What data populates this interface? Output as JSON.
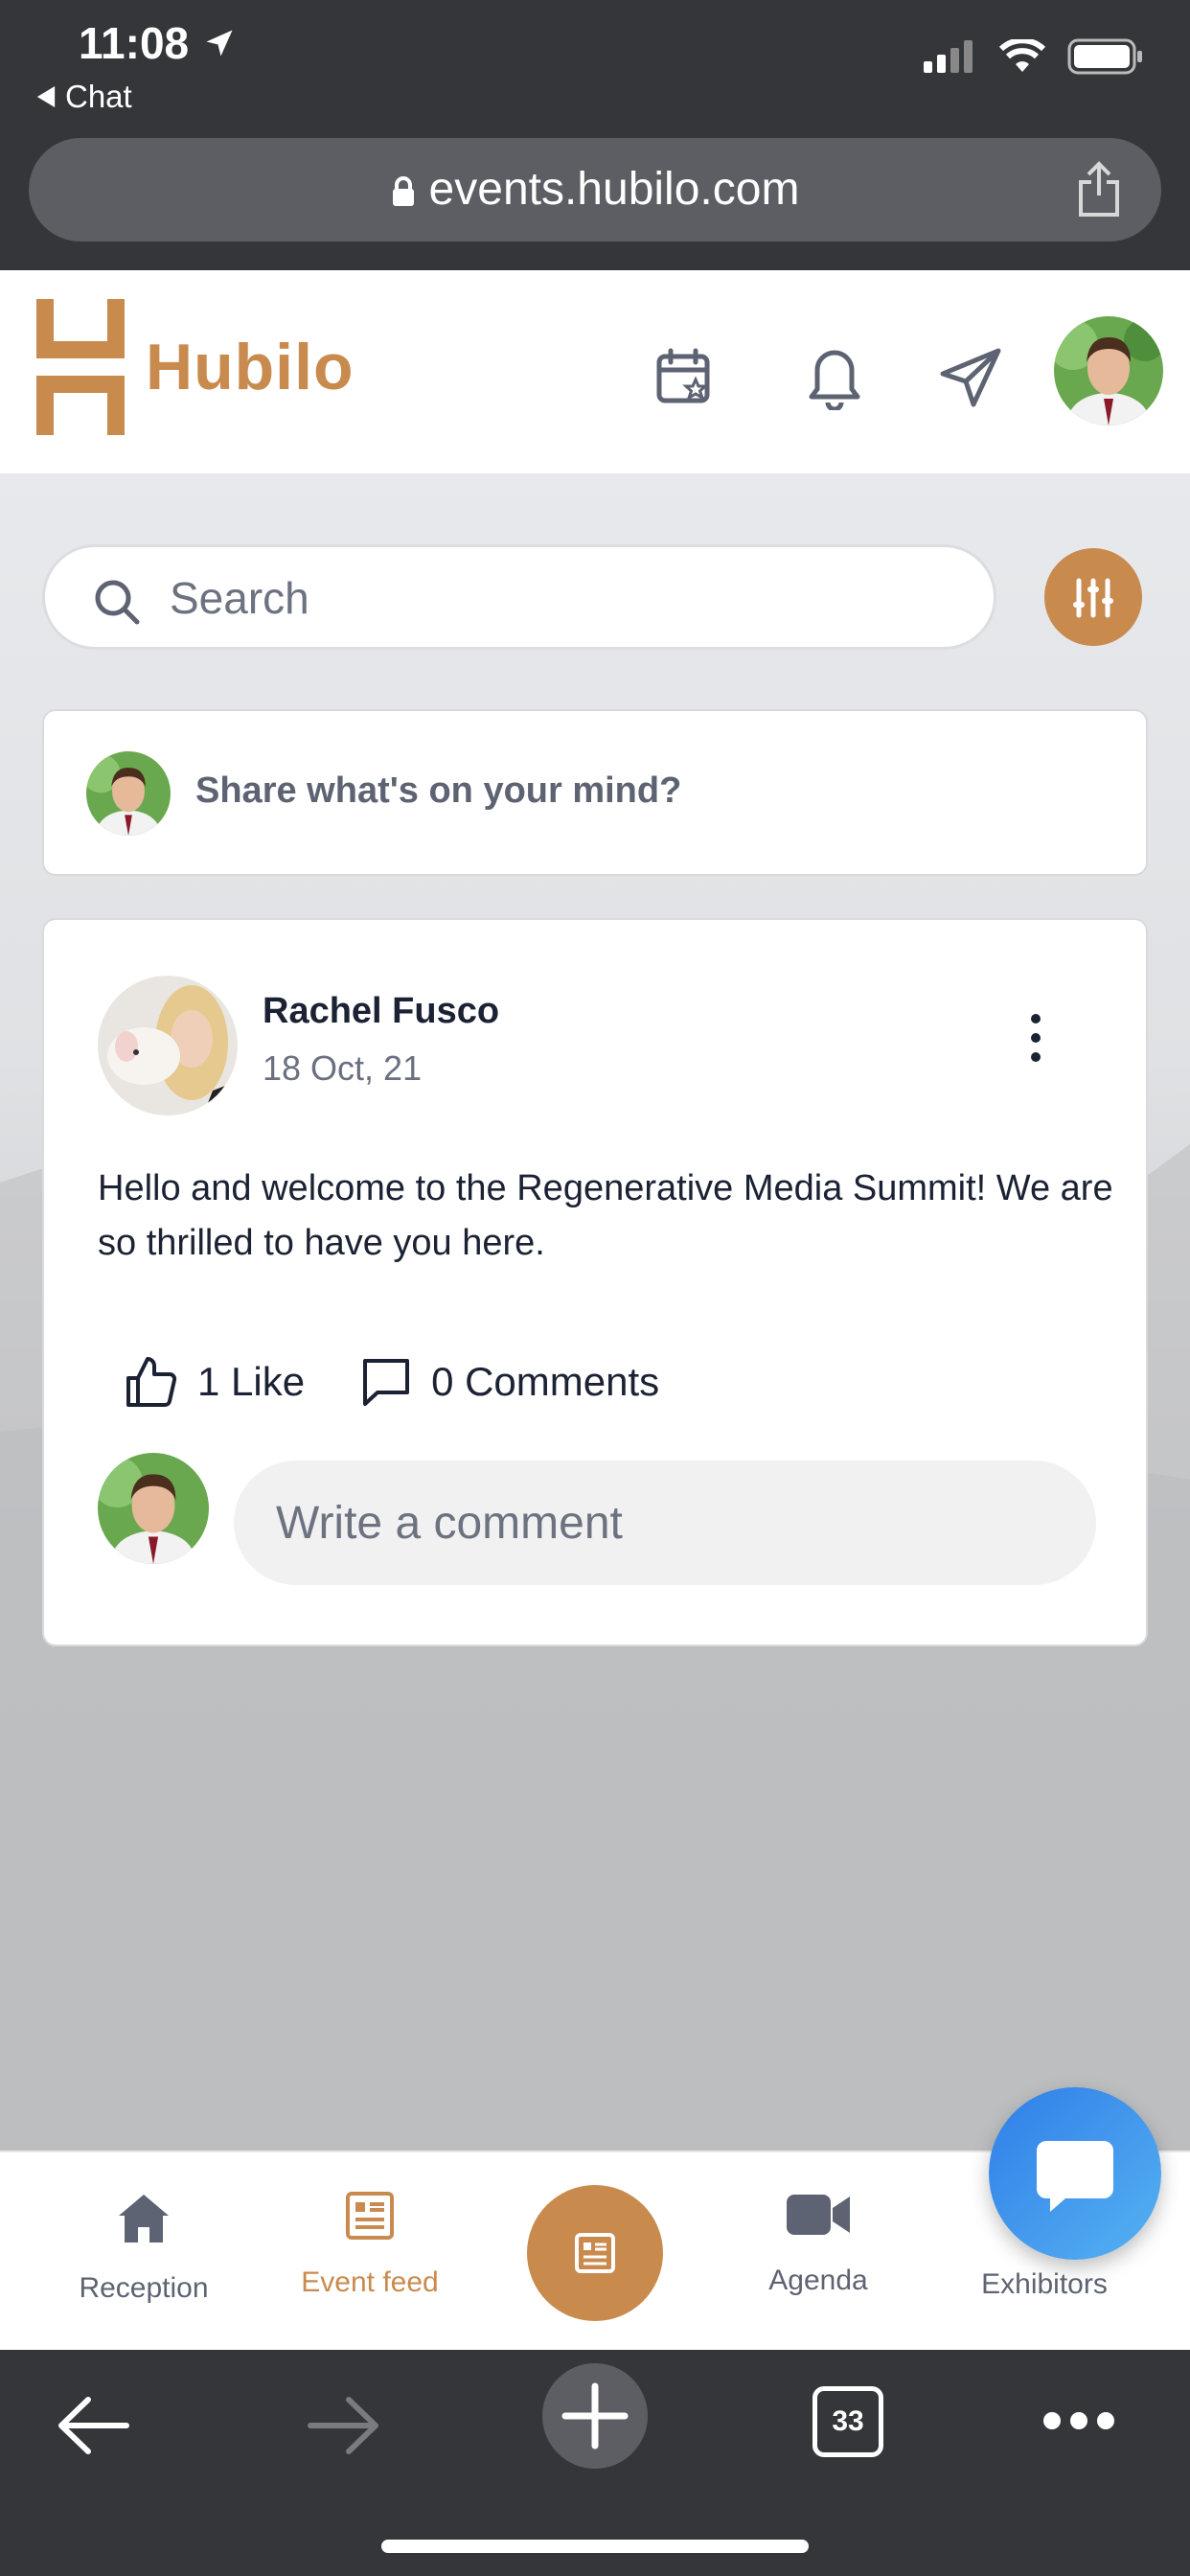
{
  "status_bar": {
    "time": "11:08",
    "back_label": "Chat",
    "icons": [
      "location-arrow-icon",
      "signal-icon",
      "wifi-icon",
      "battery-icon"
    ]
  },
  "browser": {
    "url": "events.hubilo.com",
    "tab_count": "33"
  },
  "app_header": {
    "brand": "Hubilo",
    "brand_color": "#c98a4e",
    "icons": [
      "calendar-star-icon",
      "bell-icon",
      "send-icon",
      "profile-avatar"
    ]
  },
  "search": {
    "placeholder": "Search"
  },
  "composer": {
    "prompt": "Share what's on your mind?"
  },
  "post": {
    "author": "Rachel Fusco",
    "date": "18 Oct, 21",
    "body": "Hello and welcome to the Regenerative Media Summit! We are so thrilled to have you here.",
    "like_label": "1 Like",
    "comments_label": "0 Comments",
    "comment_placeholder": "Write a comment"
  },
  "bottom_nav": {
    "items": [
      {
        "label": "Reception",
        "icon": "home-icon"
      },
      {
        "label": "Event feed",
        "icon": "feed-icon",
        "active": true
      },
      {
        "label": "",
        "icon": "feed-center-icon"
      },
      {
        "label": "Agenda",
        "icon": "video-icon"
      },
      {
        "label": "Exhibitors",
        "icon": "store-icon"
      }
    ]
  }
}
